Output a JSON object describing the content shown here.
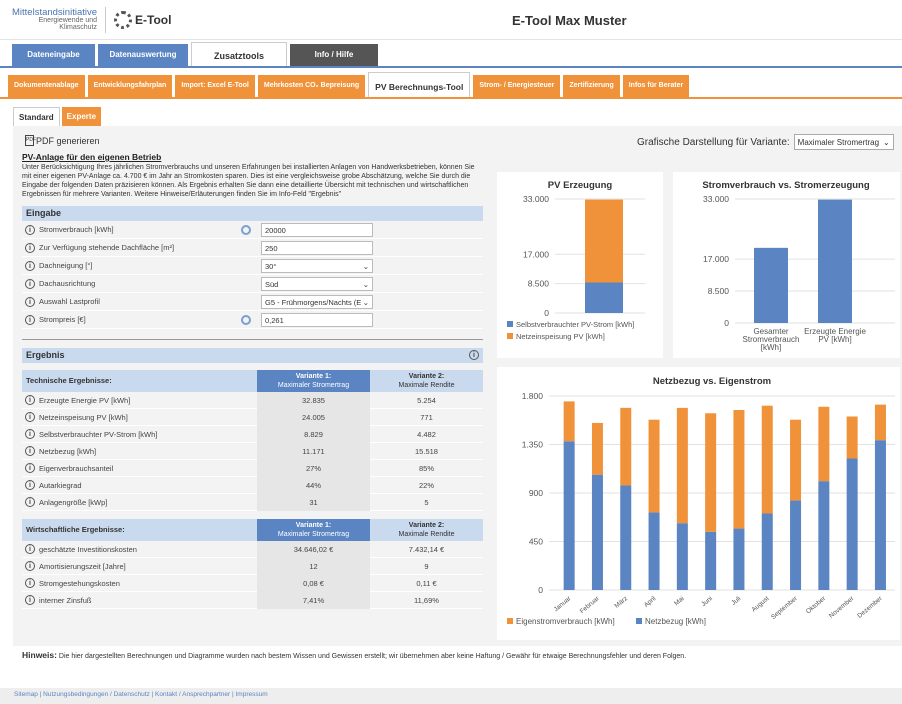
{
  "header": {
    "org_line1": "Mittelstandsinitiative",
    "org_line2": "Energiewende und",
    "org_line3": "Klimaschutz",
    "etool_logo": "E-Tool",
    "app_title": "E-Tool Max Muster"
  },
  "main_tabs": [
    "Dateneingabe",
    "Datenauswertung",
    "Zusatztools",
    "Info / Hilfe"
  ],
  "sub_tabs": [
    "Dokumentenablage",
    "Entwicklungsfahrplan",
    "Import: Excel E-Tool",
    "Mehrkosten CO₂ Bepreisung",
    "PV Berechnungs-Tool",
    "Strom- / Energiesteuer",
    "Zertifizierung",
    "Infos für Berater"
  ],
  "mode_tabs": [
    "Standard",
    "Experte"
  ],
  "pdf_label": "PDF generieren",
  "grafik_label": "Grafische Darstellung für Variante:",
  "grafik_value": "Maximaler Stromertrag",
  "page_title": "PV-Anlage für den eigenen Betrieb",
  "page_desc": "Unter Berücksichtigung Ihres jährlichen Stromverbrauchs und unseren Erfahrungen bei installierten Anlagen von Handwerksbetrieben, können Sie mit einer eigenen PV-Anlage ca. 4.700 € im Jahr an Stromkosten sparen. Dies ist eine vergleichsweise grobe Abschätzung, welche Sie durch die Eingabe der folgenden Daten präzisieren können. Als Ergebnis erhalten Sie dann eine detaillierte Übersicht mit technischen und wirtschaftlichen Ergebnissen für mehrere Varianten. Weitere Hinweise/Erläuterungen finden Sie im Info-Feld \"Ergebnis\"",
  "eingabe": {
    "title": "Eingabe",
    "rows": [
      {
        "label": "Stromverbrauch [kWh]",
        "value": "20000"
      },
      {
        "label": "Zur Verfügung stehende Dachfläche [m²]",
        "value": "250"
      },
      {
        "label": "Dachneigung [°]",
        "value": "30°"
      },
      {
        "label": "Dachausrichtung",
        "value": "Süd"
      },
      {
        "label": "Auswahl Lastprofil",
        "value": "G5 - Frühmorgens/Nachts (E"
      },
      {
        "label": "Strompreis [€]",
        "value": "0,261"
      }
    ]
  },
  "ergebnis": {
    "title": "Ergebnis",
    "tech_title": "Technische Ergebnisse:",
    "var1_a": "Variante 1:",
    "var1_b": "Maximaler Stromertrag",
    "var2_a": "Variante 2:",
    "var2_b": "Maximale Rendite",
    "tech_rows": [
      {
        "label": "Erzeugte Energie PV [kWh]",
        "v1": "32.835",
        "v2": "5.254"
      },
      {
        "label": "Netzeinspeisung PV [kWh]",
        "v1": "24.005",
        "v2": "771"
      },
      {
        "label": "Selbstverbrauchter PV-Strom [kWh]",
        "v1": "8.829",
        "v2": "4.482"
      },
      {
        "label": "Netzbezug [kWh]",
        "v1": "11.171",
        "v2": "15.518"
      },
      {
        "label": "Eigenverbrauchsanteil",
        "v1": "27%",
        "v2": "85%"
      },
      {
        "label": "Autarkiegrad",
        "v1": "44%",
        "v2": "22%"
      },
      {
        "label": "Anlagengröße [kWp]",
        "v1": "31",
        "v2": "5"
      }
    ],
    "wirt_title": "Wirtschaftliche Ergebnisse:",
    "wirt_rows": [
      {
        "label": "geschätzte Investitionskosten",
        "v1": "34.646,02 €",
        "v2": "7.432,14 €"
      },
      {
        "label": "Amortisierungszeit [Jahre]",
        "v1": "12",
        "v2": "9"
      },
      {
        "label": "Stromgestehungskosten",
        "v1": "0,08 €",
        "v2": "0,11 €"
      },
      {
        "label": "interner Zinsfuß",
        "v1": "7,41%",
        "v2": "11,69%"
      }
    ]
  },
  "hinweis_label": "Hinweis:",
  "hinweis_text": "Die hier dargestellten Berechnungen und Diagramme wurden nach bestem Wissen und Gewissen erstellt; wir übernehmen aber keine Haftung / Gewähr für etwaige Berechnungsfehler und deren Folgen.",
  "footer": "Sitemap | Nutzungsbedingungen / Datenschutz | Kontakt / Ansprechpartner | Impressum",
  "colors": {
    "blue": "#5a84c2",
    "orange": "#f0923a"
  },
  "chart_data": [
    {
      "type": "bar",
      "title": "PV Erzeugung",
      "stacked": true,
      "categories": [
        ""
      ],
      "series": [
        {
          "name": "Selbstverbrauchter PV-Strom [kWh]",
          "values": [
            8829
          ],
          "color": "#5a84c2"
        },
        {
          "name": "Netzeinspeisung PV [kWh]",
          "values": [
            24005
          ],
          "color": "#f0923a"
        }
      ],
      "yticks": [
        "0",
        "8.500",
        "17.000",
        "33.000"
      ],
      "ylim": [
        0,
        33000
      ]
    },
    {
      "type": "bar",
      "title": "Stromverbrauch vs. Stromerzeugung",
      "categories": [
        "Gesamter Stromverbrauch [kWh]",
        "Erzeugte Energie PV [kWh]"
      ],
      "values": [
        20000,
        32835
      ],
      "yticks": [
        "0",
        "8.500",
        "17.000",
        "33.000"
      ],
      "ylim": [
        0,
        33000
      ]
    },
    {
      "type": "bar",
      "title": "Netzbezug vs. Eigenstrom",
      "stacked": true,
      "categories": [
        "Januar",
        "Februar",
        "März",
        "April",
        "Mai",
        "Juni",
        "Juli",
        "August",
        "September",
        "Oktober",
        "November",
        "Dezember"
      ],
      "series": [
        {
          "name": "Netzbezug [kWh]",
          "values": [
            1380,
            1070,
            970,
            720,
            620,
            540,
            570,
            710,
            830,
            1010,
            1220,
            1390
          ],
          "color": "#5a84c2"
        },
        {
          "name": "Eigenstromverbrauch [kWh]",
          "values": [
            370,
            480,
            720,
            860,
            1070,
            1100,
            1100,
            1000,
            750,
            690,
            390,
            330
          ],
          "color": "#f0923a"
        }
      ],
      "yticks": [
        "0",
        "450",
        "900",
        "1.350",
        "1.800"
      ],
      "ylim": [
        0,
        1800
      ]
    }
  ]
}
